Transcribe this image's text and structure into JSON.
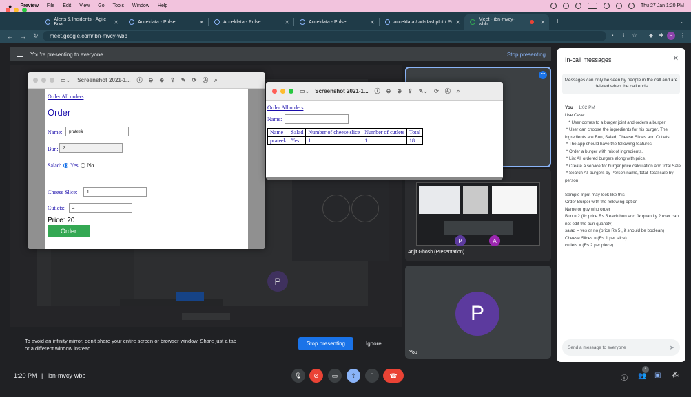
{
  "menubar": {
    "apple": "",
    "items": [
      "Preview",
      "File",
      "Edit",
      "View",
      "Go",
      "Tools",
      "Window",
      "Help"
    ],
    "clock": "Thu 27 Jan  1:20 PM"
  },
  "browser": {
    "tabs": [
      {
        "label": "Alerts & Incidents - Agile Boar"
      },
      {
        "label": "Acceldata - Pulse"
      },
      {
        "label": "Acceldata - Pulse"
      },
      {
        "label": "Acceldata - Pulse"
      },
      {
        "label": "acceldata / ad-dashplot / Pipel"
      },
      {
        "label": "Meet - ibn-mvcy-wbb"
      }
    ],
    "new_tab": "+",
    "url": "meet.google.com/ibn-mvcy-wbb",
    "profile_initial": "P"
  },
  "presenting": {
    "banner": "You're presenting to everyone",
    "stop_link": "Stop presenting"
  },
  "order_window": {
    "title": "Screenshot 2021-1...",
    "link": "Order All orders",
    "heading": "Order",
    "name_label": "Name:",
    "name_value": "prateek",
    "bun_label": "Bun:",
    "bun_value": "2",
    "salad_label": "Salad:",
    "salad_yes": "Yes",
    "salad_no": "No",
    "cheese_label": "Cheese Slice:",
    "cheese_value": "1",
    "cutlets_label": "Cutlets:",
    "cutlets_value": "2",
    "price": "Price: 20",
    "order_button": "Order"
  },
  "orders_window": {
    "title": "Screenshot 2021-1...",
    "link": "Order All orders",
    "name_label": "Name:",
    "columns": [
      "Name",
      "Salad",
      "Number of cheese slice",
      "Number of cutlets",
      "Total"
    ],
    "rows": [
      [
        "prateek",
        "Yes",
        "1",
        "1",
        "18"
      ]
    ]
  },
  "participants": {
    "presenter_label": "Arijit Ghosh (Presentation)",
    "you_label": "You",
    "avatar_initial": "P",
    "shared_avatar_initial": "P"
  },
  "warning": {
    "text": "To avoid an infinity mirror, don't share your entire screen or browser window. Share just a tab or a different window instead.",
    "stop_button": "Stop presenting",
    "ignore_button": "Ignore"
  },
  "meeting_bar": {
    "time": "1:20 PM",
    "separator": "|",
    "code": "ibn-mvcy-wbb",
    "people_count": "4"
  },
  "chat": {
    "title": "In-call messages",
    "note": "Messages can only be seen by people in the call and are deleted when the call ends",
    "sender": "You",
    "time": "1:02 PM",
    "message": "Use Case:\n   * User comes to a burger joint and orders a burger\n * User can choose the ingredients for his burger. The ingredients are Bun, Salad, Cheese Slices and Cutlets\n * The app should have the following features\n * Order a burger with mix of ingredients.\n * List All ordered burgers along with price.\n * Create a service for burger price calculation and total Sale\n * Search All burgers by Person name, total  total sale by person\n\nSample Input may look like this\nOrder Burger with the following option\nName or guy who order\nBun = 2 (fix price Rs 5 each bun and fix quantity 2 user can not edit the bun quantity)\nsalad = yes or no (price Rs 5 , it should be boolean)\nCheese Slices = (Rs 1 per slice)\ncutlets = (Rs 2 per piece)",
    "input_placeholder": "Send a message to everyone"
  },
  "colors": {
    "menubar": "#f2c3dd",
    "tabstrip": "#1f3b48",
    "accent": "#1a73e8",
    "hangup": "#ea4335",
    "order_button": "#34a853",
    "avatar": "#5c3a9e"
  }
}
